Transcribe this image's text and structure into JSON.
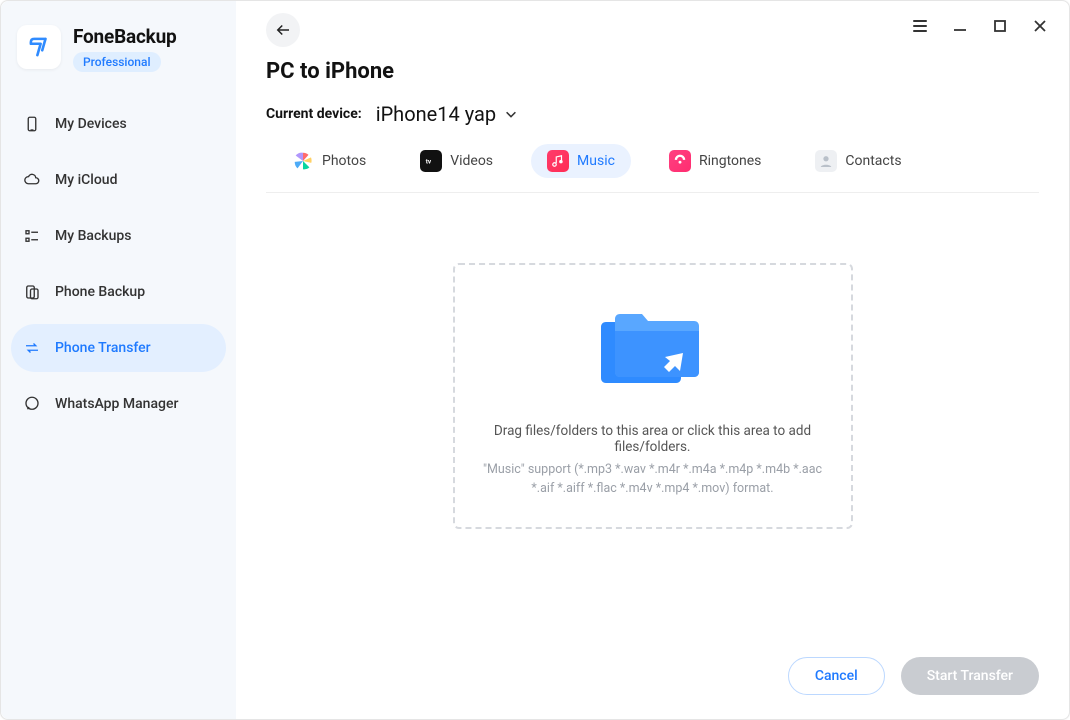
{
  "brand": {
    "title": "FoneBackup",
    "badge": "Professional"
  },
  "sidebar": {
    "items": [
      {
        "label": "My Devices"
      },
      {
        "label": "My iCloud"
      },
      {
        "label": "My Backups"
      },
      {
        "label": "Phone Backup"
      },
      {
        "label": "Phone Transfer"
      },
      {
        "label": "WhatsApp Manager"
      }
    ]
  },
  "page": {
    "title": "PC to iPhone",
    "device_label": "Current device:",
    "device_name": "iPhone14 yap"
  },
  "tabs": {
    "photos": "Photos",
    "videos": "Videos",
    "music": "Music",
    "ringtones": "Ringtones",
    "contacts": "Contacts"
  },
  "dropzone": {
    "text": "Drag files/folders to this area or click this area to add files/folders.",
    "support": "\"Music\" support (*.mp3 *.wav *.m4r *.m4a *.m4p *.m4b *.aac *.aif *.aiff *.flac *.m4v *.mp4 *.mov) format."
  },
  "footer": {
    "cancel": "Cancel",
    "start": "Start Transfer"
  }
}
